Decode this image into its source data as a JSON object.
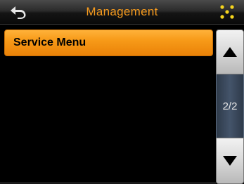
{
  "header": {
    "title": "Management",
    "back_icon": "back-arrow-icon",
    "home_icon": "grid-dots-icon",
    "title_color": "#f59a1e"
  },
  "menu": {
    "items": [
      {
        "label": "Service Menu",
        "selected": true
      }
    ]
  },
  "pagination": {
    "page_indicator": "2/2",
    "up_icon": "up-arrow-icon",
    "down_icon": "down-arrow-icon"
  },
  "colors": {
    "accent": "#f79a18",
    "background": "#000000",
    "track": "#44546a"
  }
}
